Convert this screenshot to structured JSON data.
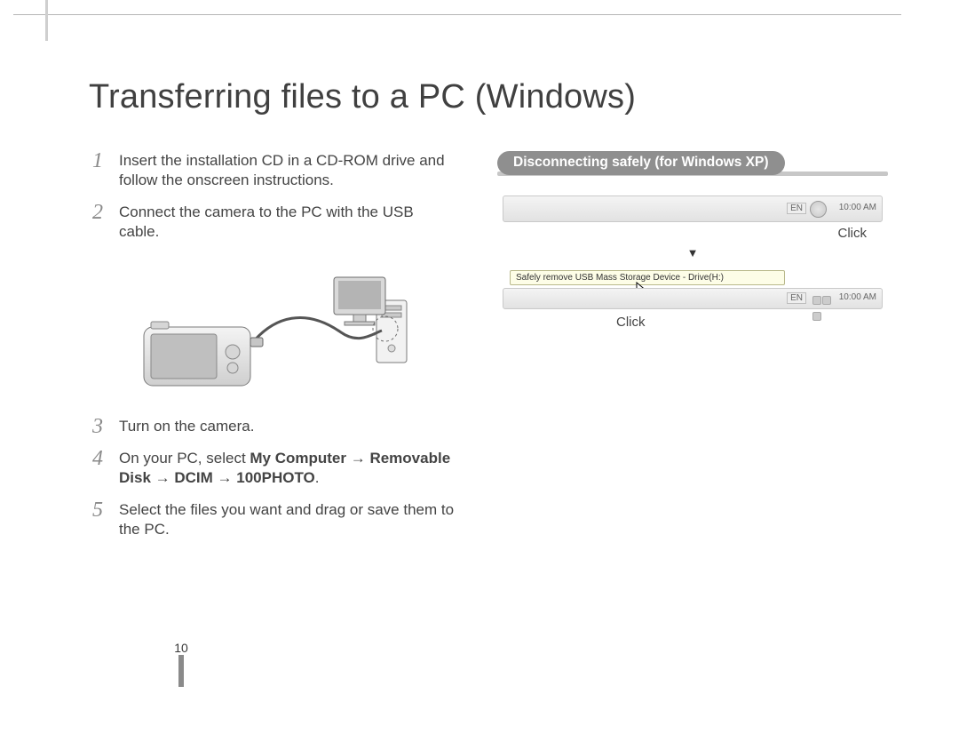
{
  "title": "Transferring files to a PC (Windows)",
  "steps": {
    "s1": {
      "num": "1",
      "text": "Insert the installation CD in a CD-ROM drive and follow the onscreen instructions."
    },
    "s2": {
      "num": "2",
      "text": "Connect the camera to the PC with the USB cable."
    },
    "s3": {
      "num": "3",
      "text": "Turn on the camera."
    },
    "s4": {
      "num": "4",
      "prefix": "On your PC, select ",
      "bold": "My Computer → Removable Disk → DCIM → 100PHOTO",
      "suffix": "."
    },
    "s5": {
      "num": "5",
      "text": "Select the files you want and drag or save them to the PC."
    }
  },
  "right": {
    "heading": "Disconnecting safely (for Windows XP)",
    "taskbar1": {
      "lang": "EN",
      "time": "10:00 AM"
    },
    "click1": "Click",
    "arrow": "▼",
    "balloon": "Safely remove USB Mass Storage Device - Drive(H:)",
    "taskbar2": {
      "lang": "EN",
      "time": "10:00 AM"
    },
    "click2": "Click"
  },
  "page_number": "10"
}
